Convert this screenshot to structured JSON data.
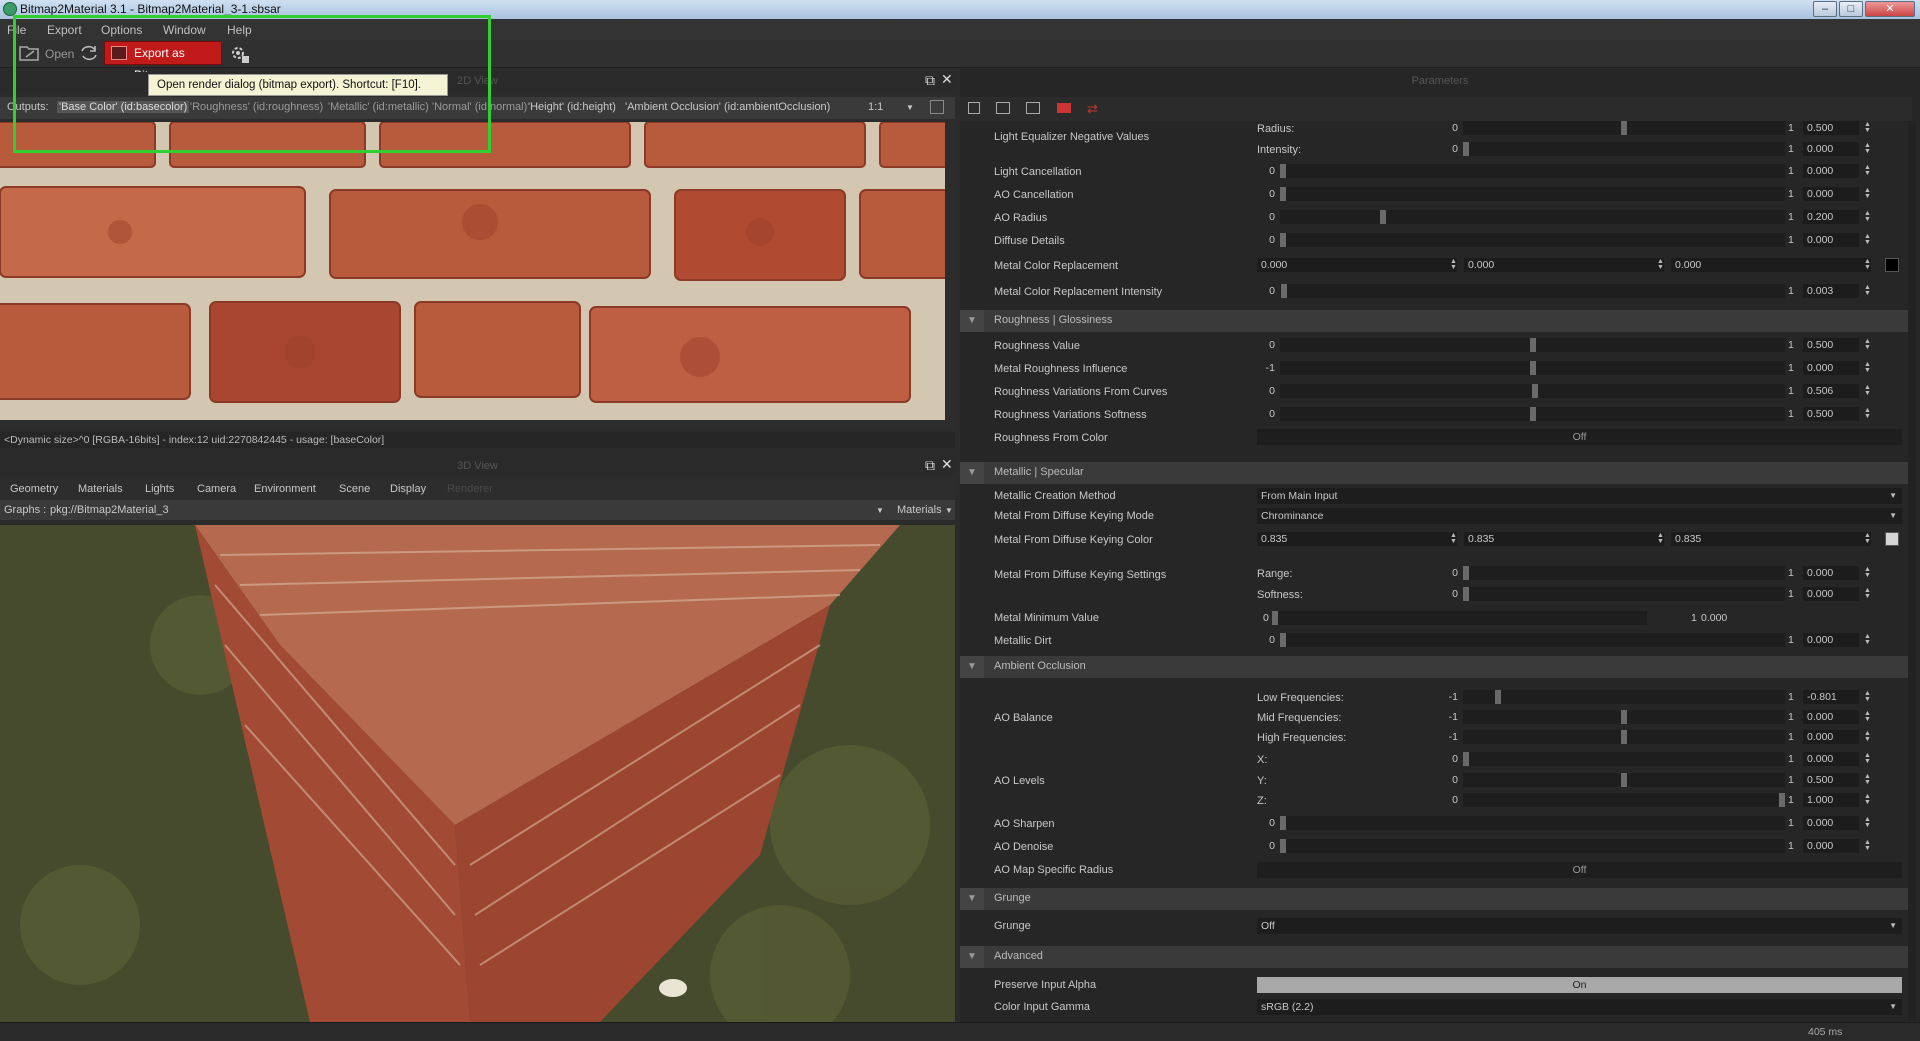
{
  "window": {
    "title": "Bitmap2Material 3.1 - Bitmap2Material_3-1.sbsar",
    "min": "–",
    "max": "□",
    "close": "✕"
  },
  "menu": [
    "File",
    "Export",
    "Options",
    "Window",
    "Help"
  ],
  "toolbar": {
    "open_label": "Open",
    "export_label": "Export as Bitmap"
  },
  "tooltip": "Open render dialog (bitmap export). Shortcut: [F10].",
  "view2d": {
    "title": "2D View",
    "outputs_label": "Outputs:",
    "outputs": [
      "'Base Color' (id:basecolor)",
      "'Roughness' (id:roughness)",
      "'Metallic' (id:metallic)",
      "'Normal' (id:normal)",
      "'Height' (id:height)",
      "'Ambient Occlusion' (id:ambientOcclusion)"
    ],
    "zoom": "1:1",
    "status": "<Dynamic size>^0 [RGBA-16bits] - index:12 uid:2270842445 - usage: [baseColor]"
  },
  "view3d": {
    "title": "3D View",
    "tabs": [
      "Geometry",
      "Materials",
      "Lights",
      "Camera",
      "Environment",
      "Scene",
      "Display",
      "Renderer"
    ],
    "graphs_label": "Graphs :",
    "graphs_value": "pkg://Bitmap2Material_3",
    "materials_label": "Materials"
  },
  "params": {
    "title": "Parameters",
    "rows": {
      "le_label": "Light Equalizer Negative Values",
      "le_radius": "Radius:",
      "le_intensity": "Intensity:",
      "lc": "Light Cancellation",
      "aoc": "AO Cancellation",
      "aor": "AO Radius",
      "dd": "Diffuse Details",
      "mcr": "Metal Color Replacement",
      "mcri": "Metal Color Replacement Intensity",
      "sec_rough": "Roughness | Glossiness",
      "rv": "Roughness Value",
      "mri": "Metal Roughness Influence",
      "rvc": "Roughness Variations From Curves",
      "rvs": "Roughness Variations Softness",
      "rfc": "Roughness From Color",
      "sec_metal": "Metallic | Specular",
      "mcm": "Metallic Creation Method",
      "mfdkm": "Metal From Diffuse Keying Mode",
      "mfdkc": "Metal From Diffuse Keying Color",
      "mfdks": "Metal From Diffuse Keying Settings",
      "range": "Range:",
      "softness": "Softness:",
      "mmv": "Metal Minimum Value",
      "md": "Metallic Dirt",
      "sec_ao": "Ambient Occlusion",
      "aob": "AO Balance",
      "lowf": "Low Frequencies:",
      "midf": "Mid Frequencies:",
      "highf": "High Frequencies:",
      "aol": "AO Levels",
      "x": "X:",
      "y": "Y:",
      "z": "Z:",
      "aos": "AO Sharpen",
      "aod": "AO Denoise",
      "aomsr": "AO Map Specific Radius",
      "sec_grunge": "Grunge",
      "grunge": "Grunge",
      "sec_adv": "Advanced",
      "pia": "Preserve Input Alpha",
      "cig": "Color Input Gamma"
    },
    "values": {
      "le_radius": {
        "min": "0",
        "max": "1",
        "val": "0.500",
        "pos": 0.5
      },
      "le_intensity": {
        "min": "0",
        "max": "1",
        "val": "0.000",
        "pos": 0
      },
      "lc": {
        "min": "0",
        "max": "1",
        "val": "0.000",
        "pos": 0
      },
      "aoc": {
        "min": "0",
        "max": "1",
        "val": "0.000",
        "pos": 0
      },
      "aor": {
        "min": "0",
        "max": "1",
        "val": "0.200",
        "pos": 0.2
      },
      "dd": {
        "min": "0",
        "max": "1",
        "val": "0.000",
        "pos": 0
      },
      "mcri": {
        "min": "0",
        "max": "1",
        "val": "0.003",
        "pos": 0.003
      },
      "rv": {
        "min": "0",
        "max": "1",
        "val": "0.500",
        "pos": 0.5
      },
      "mri": {
        "min": "-1",
        "max": "1",
        "val": "0.000",
        "pos": 0.5
      },
      "rvc": {
        "min": "0",
        "max": "1",
        "val": "0.506",
        "pos": 0.506
      },
      "rvs": {
        "min": "0",
        "max": "1",
        "val": "0.500",
        "pos": 0.5
      },
      "range": {
        "min": "0",
        "max": "1",
        "val": "0.000",
        "pos": 0
      },
      "softness": {
        "min": "0",
        "max": "1",
        "val": "0.000",
        "pos": 0
      },
      "md": {
        "min": "0",
        "max": "1",
        "val": "0.000",
        "pos": 0
      },
      "lowf": {
        "min": "-1",
        "max": "1",
        "val": "-0.801",
        "pos": 0.1
      },
      "midf": {
        "min": "-1",
        "max": "1",
        "val": "0.000",
        "pos": 0.5
      },
      "highf": {
        "min": "-1",
        "max": "1",
        "val": "0.000",
        "pos": 0.5
      },
      "x": {
        "min": "0",
        "max": "1",
        "val": "0.000",
        "pos": 0
      },
      "y": {
        "min": "0",
        "max": "1",
        "val": "0.500",
        "pos": 0.5
      },
      "z": {
        "min": "0",
        "max": "1",
        "val": "1.000",
        "pos": 1
      },
      "aos": {
        "min": "0",
        "max": "1",
        "val": "0.000",
        "pos": 0
      },
      "aod": {
        "min": "0",
        "max": "1",
        "val": "0.000",
        "pos": 0
      }
    },
    "mcr_vals": [
      "0.000",
      "0.000",
      "0.000"
    ],
    "mfdkc_vals": [
      "0.835",
      "0.835",
      "0.835"
    ],
    "mmv": {
      "min": "0",
      "max": "1",
      "val": "0.000"
    },
    "rfc_val": "Off",
    "aomsr_val": "Off",
    "mcm_val": "From Main Input",
    "mfdkm_val": "Chrominance",
    "grunge_val": "Off",
    "pia_val": "On",
    "cig_val": "sRGB (2.2)"
  },
  "status_time": "405 ms",
  "colors": {
    "export_button": "#c01a1a",
    "highlight": "#30d030",
    "metal_color": "#000000",
    "keying_color": "#d5d5d5"
  }
}
